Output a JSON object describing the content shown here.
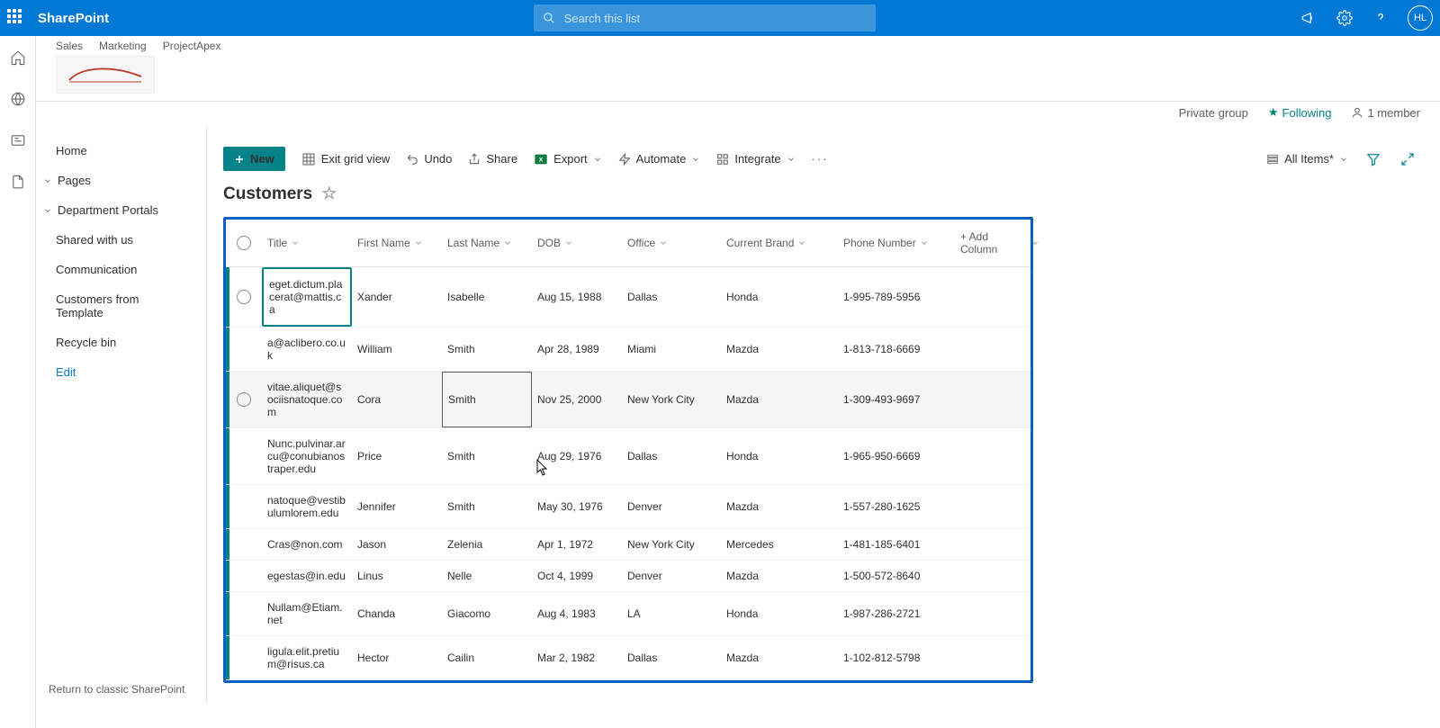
{
  "header": {
    "brand": "SharePoint",
    "search_placeholder": "Search this list",
    "avatar_initials": "HL"
  },
  "site": {
    "tabs": [
      "Sales",
      "Marketing",
      "ProjectApex"
    ],
    "private_label": "Private group",
    "following_label": "Following",
    "members_label": "1 member"
  },
  "nav": {
    "home": "Home",
    "pages": "Pages",
    "dept": "Department Portals",
    "shared": "Shared with us",
    "comm": "Communication",
    "cft": "Customers from Template",
    "recycle": "Recycle bin",
    "edit": "Edit",
    "classic": "Return to classic SharePoint"
  },
  "toolbar": {
    "new": "New",
    "exit": "Exit grid view",
    "undo": "Undo",
    "share": "Share",
    "export": "Export",
    "automate": "Automate",
    "integrate": "Integrate",
    "view": "All Items*"
  },
  "list": {
    "title": "Customers",
    "columns": {
      "title": "Title",
      "first": "First Name",
      "last": "Last Name",
      "dob": "DOB",
      "office": "Office",
      "brand": "Current Brand",
      "phone": "Phone Number",
      "add": "+ Add Column"
    },
    "rows": [
      {
        "title": "eget.dictum.placerat@mattis.ca",
        "first": "Xander",
        "last": "Isabelle",
        "dob": "Aug 15, 1988",
        "office": "Dallas",
        "brand": "Honda",
        "phone": "1-995-789-5956"
      },
      {
        "title": "a@aclibero.co.uk",
        "first": "William",
        "last": "Smith",
        "dob": "Apr 28, 1989",
        "office": "Miami",
        "brand": "Mazda",
        "phone": "1-813-718-6669"
      },
      {
        "title": "vitae.aliquet@sociisnatoque.com",
        "first": "Cora",
        "last": "Smith",
        "dob": "Nov 25, 2000",
        "office": "New York City",
        "brand": "Mazda",
        "phone": "1-309-493-9697"
      },
      {
        "title": "Nunc.pulvinar.arcu@conubianostraper.edu",
        "first": "Price",
        "last": "Smith",
        "dob": "Aug 29, 1976",
        "office": "Dallas",
        "brand": "Honda",
        "phone": "1-965-950-6669"
      },
      {
        "title": "natoque@vestibulumlorem.edu",
        "first": "Jennifer",
        "last": "Smith",
        "dob": "May 30, 1976",
        "office": "Denver",
        "brand": "Mazda",
        "phone": "1-557-280-1625"
      },
      {
        "title": "Cras@non.com",
        "first": "Jason",
        "last": "Zelenia",
        "dob": "Apr 1, 1972",
        "office": "New York City",
        "brand": "Mercedes",
        "phone": "1-481-185-6401"
      },
      {
        "title": "egestas@in.edu",
        "first": "Linus",
        "last": "Nelle",
        "dob": "Oct 4, 1999",
        "office": "Denver",
        "brand": "Mazda",
        "phone": "1-500-572-8640"
      },
      {
        "title": "Nullam@Etiam.net",
        "first": "Chanda",
        "last": "Giacomo",
        "dob": "Aug 4, 1983",
        "office": "LA",
        "brand": "Honda",
        "phone": "1-987-286-2721"
      },
      {
        "title": "ligula.elit.pretium@risus.ca",
        "first": "Hector",
        "last": "Cailin",
        "dob": "Mar 2, 1982",
        "office": "Dallas",
        "brand": "Mazda",
        "phone": "1-102-812-5798"
      }
    ]
  }
}
